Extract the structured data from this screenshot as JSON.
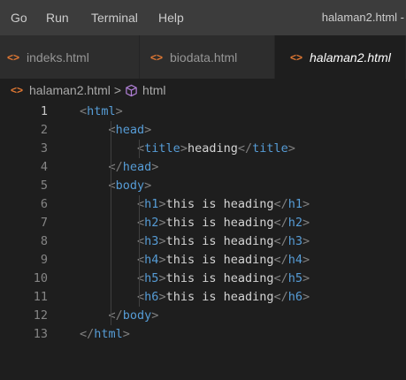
{
  "menubar": {
    "items": [
      "Go",
      "Run",
      "Terminal",
      "Help"
    ],
    "title": "halaman2.html -"
  },
  "tabs": [
    {
      "label": "indeks.html",
      "icon": "html-file-icon",
      "active": false
    },
    {
      "label": "biodata.html",
      "icon": "html-file-icon",
      "active": false
    },
    {
      "label": "halaman2.html",
      "icon": "html-file-icon",
      "active": true
    }
  ],
  "breadcrumb": {
    "file": "halaman2.html",
    "separator": ">",
    "symbol": "html"
  },
  "tab_icon_glyph": "<>",
  "colors": {
    "tag": "#569cd6",
    "bracket": "#808080",
    "text": "#d4d4d4",
    "html_icon": "#e37933",
    "symbol_icon": "#b180d7"
  },
  "editor": {
    "current_line": 1,
    "lines": [
      {
        "num": "1",
        "indent": 0,
        "open": "html",
        "text": "",
        "close": ""
      },
      {
        "num": "2",
        "indent": 1,
        "open": "head",
        "text": "",
        "close": ""
      },
      {
        "num": "3",
        "indent": 2,
        "open": "title",
        "text": "heading",
        "close": "title"
      },
      {
        "num": "4",
        "indent": 1,
        "open": "",
        "text": "",
        "close": "head"
      },
      {
        "num": "5",
        "indent": 1,
        "open": "body",
        "text": "",
        "close": ""
      },
      {
        "num": "6",
        "indent": 2,
        "open": "h1",
        "text": "this is heading",
        "close": "h1"
      },
      {
        "num": "7",
        "indent": 2,
        "open": "h2",
        "text": "this is heading",
        "close": "h2"
      },
      {
        "num": "8",
        "indent": 2,
        "open": "h3",
        "text": "this is heading",
        "close": "h3"
      },
      {
        "num": "9",
        "indent": 2,
        "open": "h4",
        "text": "this is heading",
        "close": "h4"
      },
      {
        "num": "10",
        "indent": 2,
        "open": "h5",
        "text": "this is heading",
        "close": "h5"
      },
      {
        "num": "11",
        "indent": 2,
        "open": "h6",
        "text": "this is heading",
        "close": "h6"
      },
      {
        "num": "12",
        "indent": 1,
        "open": "",
        "text": "",
        "close": "body"
      },
      {
        "num": "13",
        "indent": 0,
        "open": "",
        "text": "",
        "close": "html"
      }
    ]
  }
}
